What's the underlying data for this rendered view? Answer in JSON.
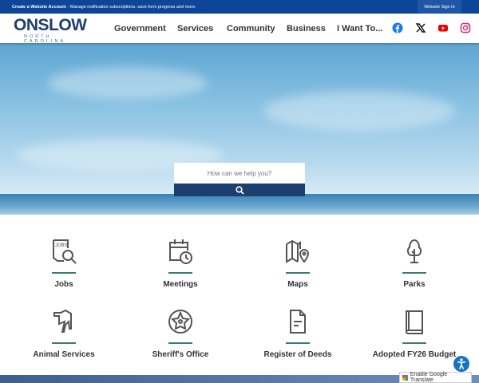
{
  "topbar": {
    "account_link": "Create a Website Account",
    "account_text": " - Manage notification subscriptions, save form progress and more.",
    "signin": "Website Sign In"
  },
  "logo": {
    "name": "ONSLOW",
    "sub": "NORTH CAROLINA"
  },
  "nav": [
    "Government",
    "Services",
    "Community",
    "Business",
    "I Want To..."
  ],
  "social": [
    "facebook-icon",
    "x-icon",
    "youtube-icon",
    "instagram-icon"
  ],
  "search": {
    "placeholder": "How can we help you?"
  },
  "tiles": [
    "Jobs",
    "Meetings",
    "Maps",
    "Parks",
    "Animal Services",
    "Sheriff's Office",
    "Register of Deeds",
    "Adopted FY26 Budget"
  ],
  "translate": "Enable Google Translate",
  "colors": {
    "topbar": "#0d4699",
    "accent": "#3c7a78",
    "search_button": "#1d3f70"
  }
}
